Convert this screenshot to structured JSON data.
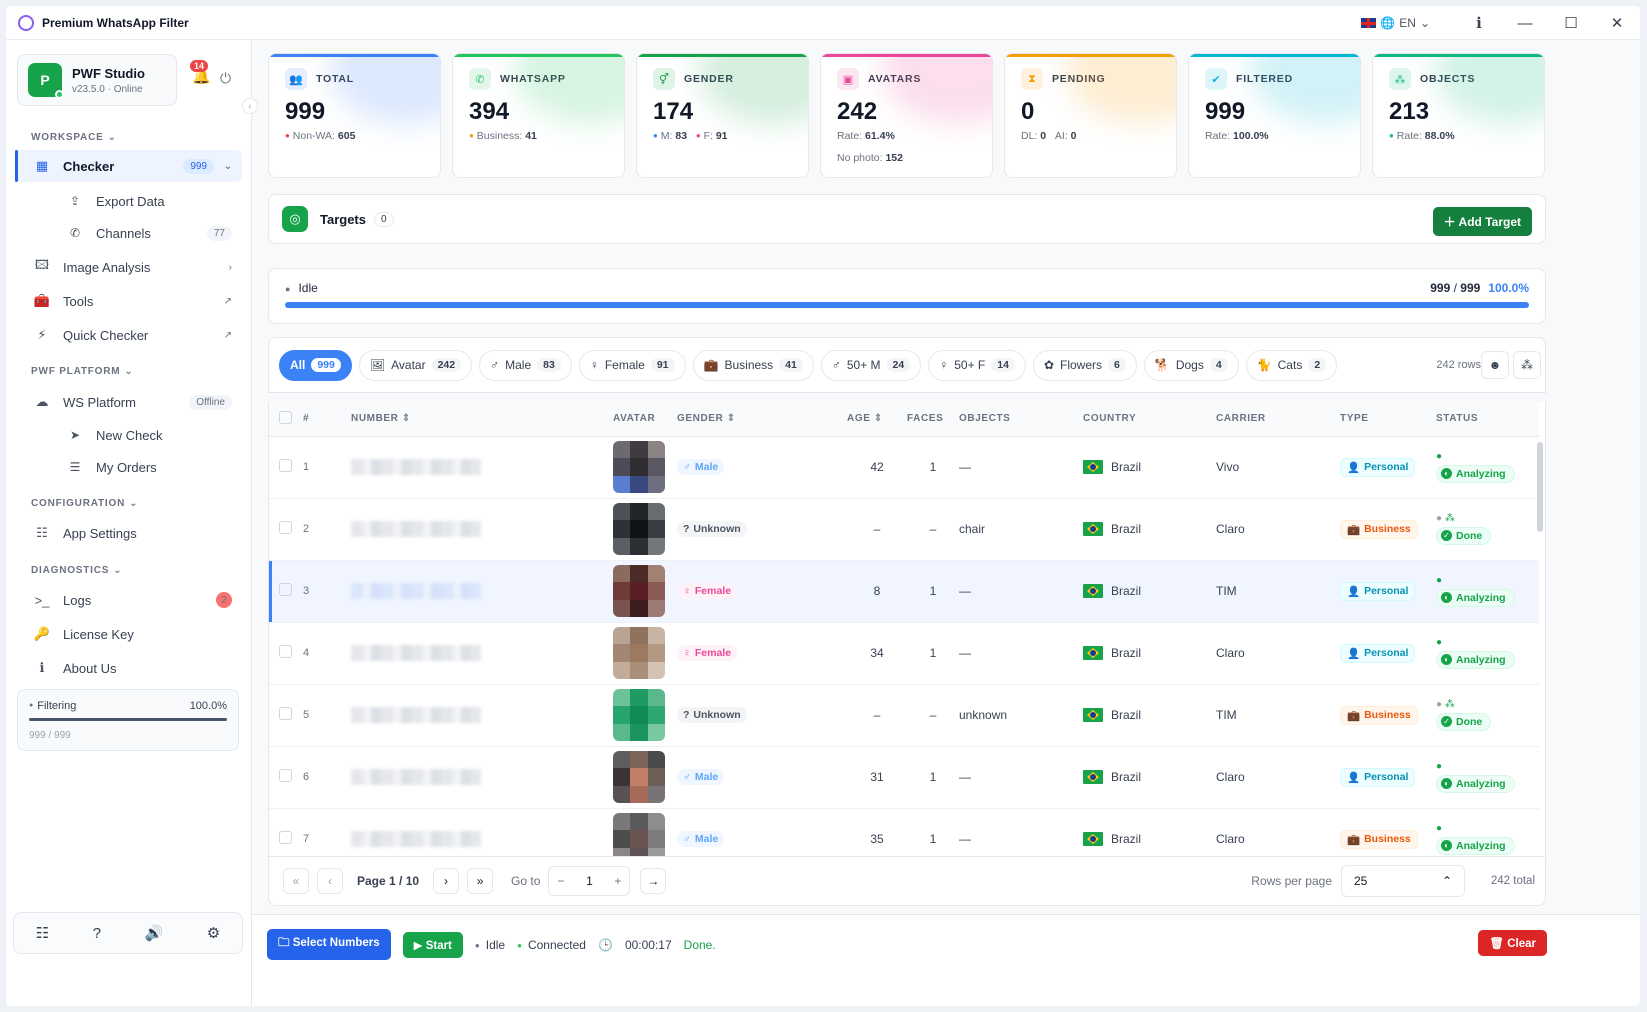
{
  "window": {
    "title": "Premium WhatsApp Filter",
    "lang": "EN"
  },
  "profile": {
    "initial": "P",
    "name": "PWF Studio",
    "sub": "v23.5.0 · Online",
    "notifications": "14"
  },
  "sidebar": {
    "workspace": "WORKSPACE",
    "checker": "Checker",
    "checker_count": "999",
    "export": "Export Data",
    "channels": "Channels",
    "channels_count": "77",
    "image_analysis": "Image Analysis",
    "tools": "Tools",
    "quick_checker": "Quick Checker",
    "platform": "PWF PLATFORM",
    "ws_platform": "WS Platform",
    "ws_status": "Offline",
    "new_check": "New Check",
    "my_orders": "My Orders",
    "configuration": "CONFIGURATION",
    "app_settings": "App Settings",
    "diagnostics": "DIAGNOSTICS",
    "logs": "Logs",
    "logs_count": "2",
    "license": "License Key",
    "about": "About Us",
    "filter_label": "Filtering",
    "filter_pct": "100.0%",
    "filter_sub": "999 / 999"
  },
  "stats": [
    {
      "label": "TOTAL",
      "value": "999",
      "icon": "users-icon",
      "color": "#3b82f6",
      "sub1": "Non-WA:",
      "sub1v": "605"
    },
    {
      "label": "WHATSAPP",
      "value": "394",
      "icon": "whatsapp-icon",
      "color": "#22c55e",
      "sub1": "Business:",
      "sub1v": "41"
    },
    {
      "label": "GENDER",
      "value": "174",
      "icon": "gender-icon",
      "color": "#16a34a",
      "sub1": "M:",
      "sub1v": "83",
      "sub2": "F:",
      "sub2v": "91"
    },
    {
      "label": "AVATARS",
      "value": "242",
      "icon": "image-icon",
      "color": "#ec4899",
      "sub1": "Rate:",
      "sub1v": "61.4%",
      "sub3": "No photo:",
      "sub3v": "152"
    },
    {
      "label": "PENDING",
      "value": "0",
      "icon": "hourglass-icon",
      "color": "#f59e0b",
      "sub1": "DL:",
      "sub1v": "0",
      "sub2": "AI:",
      "sub2v": "0"
    },
    {
      "label": "FILTERED",
      "value": "999",
      "icon": "check-circle-icon",
      "color": "#06b6d4",
      "sub1": "Rate:",
      "sub1v": "100.0%"
    },
    {
      "label": "OBJECTS",
      "value": "213",
      "icon": "shapes-icon",
      "color": "#10b981",
      "sub1": "Rate:",
      "sub1v": "88.0%"
    }
  ],
  "targets": {
    "label": "Targets",
    "count": "0",
    "add": "Add Target"
  },
  "progress": {
    "status": "Idle",
    "done": "999",
    "total": "999",
    "pct": "100.0%",
    "fraction": 1.0
  },
  "filters": [
    {
      "label": "All",
      "count": "999",
      "icon": ""
    },
    {
      "label": "Avatar",
      "count": "242",
      "icon": "🖼"
    },
    {
      "label": "Male",
      "count": "83",
      "icon": "♂"
    },
    {
      "label": "Female",
      "count": "91",
      "icon": "♀"
    },
    {
      "label": "Business",
      "count": "41",
      "icon": "💼"
    },
    {
      "label": "50+ M",
      "count": "24",
      "icon": "♂"
    },
    {
      "label": "50+ F",
      "count": "14",
      "icon": "♀"
    },
    {
      "label": "Flowers",
      "count": "6",
      "icon": "✿"
    },
    {
      "label": "Dogs",
      "count": "4",
      "icon": "🐕"
    },
    {
      "label": "Cats",
      "count": "2",
      "icon": "🐈"
    }
  ],
  "rows_info": "242 rows",
  "columns": {
    "num": "#",
    "number": "NUMBER",
    "avatar": "AVATAR",
    "gender": "GENDER",
    "age": "AGE",
    "faces": "FACES",
    "objects": "OBJECTS",
    "country": "COUNTRY",
    "carrier": "CARRIER",
    "type": "TYPE",
    "status": "STATUS"
  },
  "rows": [
    {
      "idx": "1",
      "gender": "Male",
      "age": "42",
      "faces": "1",
      "objects": "—",
      "country": "Brazil",
      "carrier": "Vivo",
      "type": "Personal",
      "status": "Analyzing",
      "av": [
        "#6b6a6e",
        "#3f3b40",
        "#8a8485",
        "#4d4b58",
        "#302d33",
        "#5c5863",
        "#5b7fd0",
        "#3b4a7e",
        "#6d6f81"
      ]
    },
    {
      "idx": "2",
      "gender": "Unknown",
      "age": "–",
      "faces": "–",
      "objects": "chair",
      "country": "Brazil",
      "carrier": "Claro",
      "type": "Business",
      "status": "Done",
      "av": [
        "#4d5054",
        "#222629",
        "#6a6d70",
        "#2e3236",
        "#101418",
        "#3a3e42",
        "#5b5e62",
        "#2b2f33",
        "#75787b"
      ]
    },
    {
      "idx": "3",
      "gender": "Female",
      "age": "8",
      "faces": "1",
      "objects": "—",
      "country": "Brazil",
      "carrier": "TIM",
      "type": "Personal",
      "status": "Analyzing",
      "av": [
        "#8b6a60",
        "#4a2b26",
        "#a38172",
        "#6f3b38",
        "#5a1f24",
        "#8c5a55",
        "#7a5450",
        "#3c1c1e",
        "#9b7b73"
      ]
    },
    {
      "idx": "4",
      "gender": "Female",
      "age": "34",
      "faces": "1",
      "objects": "—",
      "country": "Brazil",
      "carrier": "Claro",
      "type": "Personal",
      "status": "Analyzing",
      "av": [
        "#b9a493",
        "#8f735f",
        "#c8b4a2",
        "#a28672",
        "#9c7a62",
        "#b39882",
        "#c2ab98",
        "#a98e79",
        "#d3c3b4"
      ]
    },
    {
      "idx": "5",
      "gender": "Unknown",
      "age": "–",
      "faces": "–",
      "objects": "unknown",
      "country": "Brazil",
      "carrier": "TIM",
      "type": "Business",
      "status": "Done",
      "av": [
        "#6cc39a",
        "#1f9a63",
        "#5bb88b",
        "#28a56c",
        "#0f8b53",
        "#2ea872",
        "#59b98c",
        "#1c9460",
        "#79c8a2"
      ]
    },
    {
      "idx": "6",
      "gender": "Male",
      "age": "31",
      "faces": "1",
      "objects": "—",
      "country": "Brazil",
      "carrier": "Claro",
      "type": "Personal",
      "status": "Analyzing",
      "av": [
        "#5e5e60",
        "#7c6458",
        "#4b4b4e",
        "#3a3434",
        "#c27e66",
        "#6d5e58",
        "#585253",
        "#a56b58",
        "#787374"
      ]
    },
    {
      "idx": "7",
      "gender": "Male",
      "age": "35",
      "faces": "1",
      "objects": "—",
      "country": "Brazil",
      "carrier": "Claro",
      "type": "Business",
      "status": "Analyzing",
      "av": [
        "#7a7879",
        "#5c5a5b",
        "#8e8c8d",
        "#4f4c4d",
        "#6b5551",
        "#7d7b7c",
        "#8a8586",
        "#5e5355",
        "#9b9899"
      ]
    }
  ],
  "pager": {
    "page": "Page 1 / 10",
    "goto": "Go to",
    "goto_value": "1",
    "rpp_label": "Rows per page",
    "rpp_value": "25",
    "total": "242 total"
  },
  "bottom": {
    "select": "Select Numbers",
    "start": "Start",
    "state": "Idle",
    "conn": "Connected",
    "time": "00:00:17",
    "msg": "Done.",
    "clear": "Clear"
  }
}
